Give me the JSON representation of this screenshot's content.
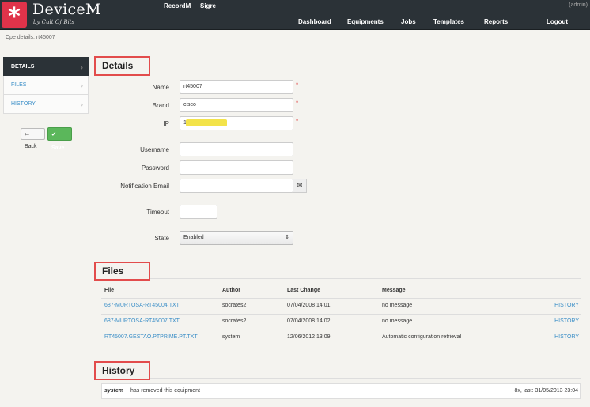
{
  "app": {
    "logo_glyph": "*",
    "title": "DeviceM",
    "subtitle": "by Cult Of Bits",
    "top_links": [
      "RecordM",
      "Sigre"
    ],
    "user": "(admin)",
    "nav": [
      "Dashboard",
      "Equipments",
      "Jobs",
      "Templates",
      "Reports",
      "Logout"
    ]
  },
  "breadcrumb": "Cpe details: rt45007",
  "sidebar": {
    "items": [
      {
        "label": "DETAILS",
        "active": true
      },
      {
        "label": "FILES",
        "active": false
      },
      {
        "label": "HISTORY",
        "active": false
      }
    ],
    "back_label": "Back",
    "save_label": "Save"
  },
  "details": {
    "heading": "Details",
    "name_label": "Name",
    "name_value": "rt45007",
    "brand_label": "Brand",
    "brand_value": "cisco",
    "ip_label": "IP",
    "ip_value": "1",
    "username_label": "Username",
    "username_value": "",
    "password_label": "Password",
    "password_value": "",
    "email_label": "Notification Email",
    "email_value": "",
    "timeout_label": "Timeout",
    "timeout_value": "",
    "state_label": "State",
    "state_value": "Enabled",
    "required_mark": "*"
  },
  "files": {
    "heading": "Files",
    "columns": [
      "File",
      "Author",
      "Last Change",
      "Message"
    ],
    "rows": [
      {
        "file": "687-MURTOSA-RT45004.TXT",
        "author": "socrates2",
        "last_change": "07/04/2008 14:01",
        "message": "no message",
        "action": "HISTORY"
      },
      {
        "file": "687-MURTOSA-RT45007.TXT",
        "author": "socrates2",
        "last_change": "07/04/2008 14:02",
        "message": "no message",
        "action": "HISTORY"
      },
      {
        "file": "RT45007.GESTAO.PTPRIME.PT.TXT",
        "author": "system",
        "last_change": "12/06/2012 13:09",
        "message": "Automatic configuration retrieval",
        "action": "HISTORY"
      }
    ]
  },
  "history": {
    "heading": "History",
    "entries": [
      {
        "who": "system",
        "text": "has removed this equipment",
        "meta": "8x, last: 31/05/2013 23:04"
      }
    ]
  },
  "colors": {
    "accent": "#e0334a",
    "header": "#2b3237",
    "link": "#3a8ec7",
    "save": "#5bb75b",
    "annotation": "#e24c4c",
    "redaction": "#f3e34a"
  }
}
